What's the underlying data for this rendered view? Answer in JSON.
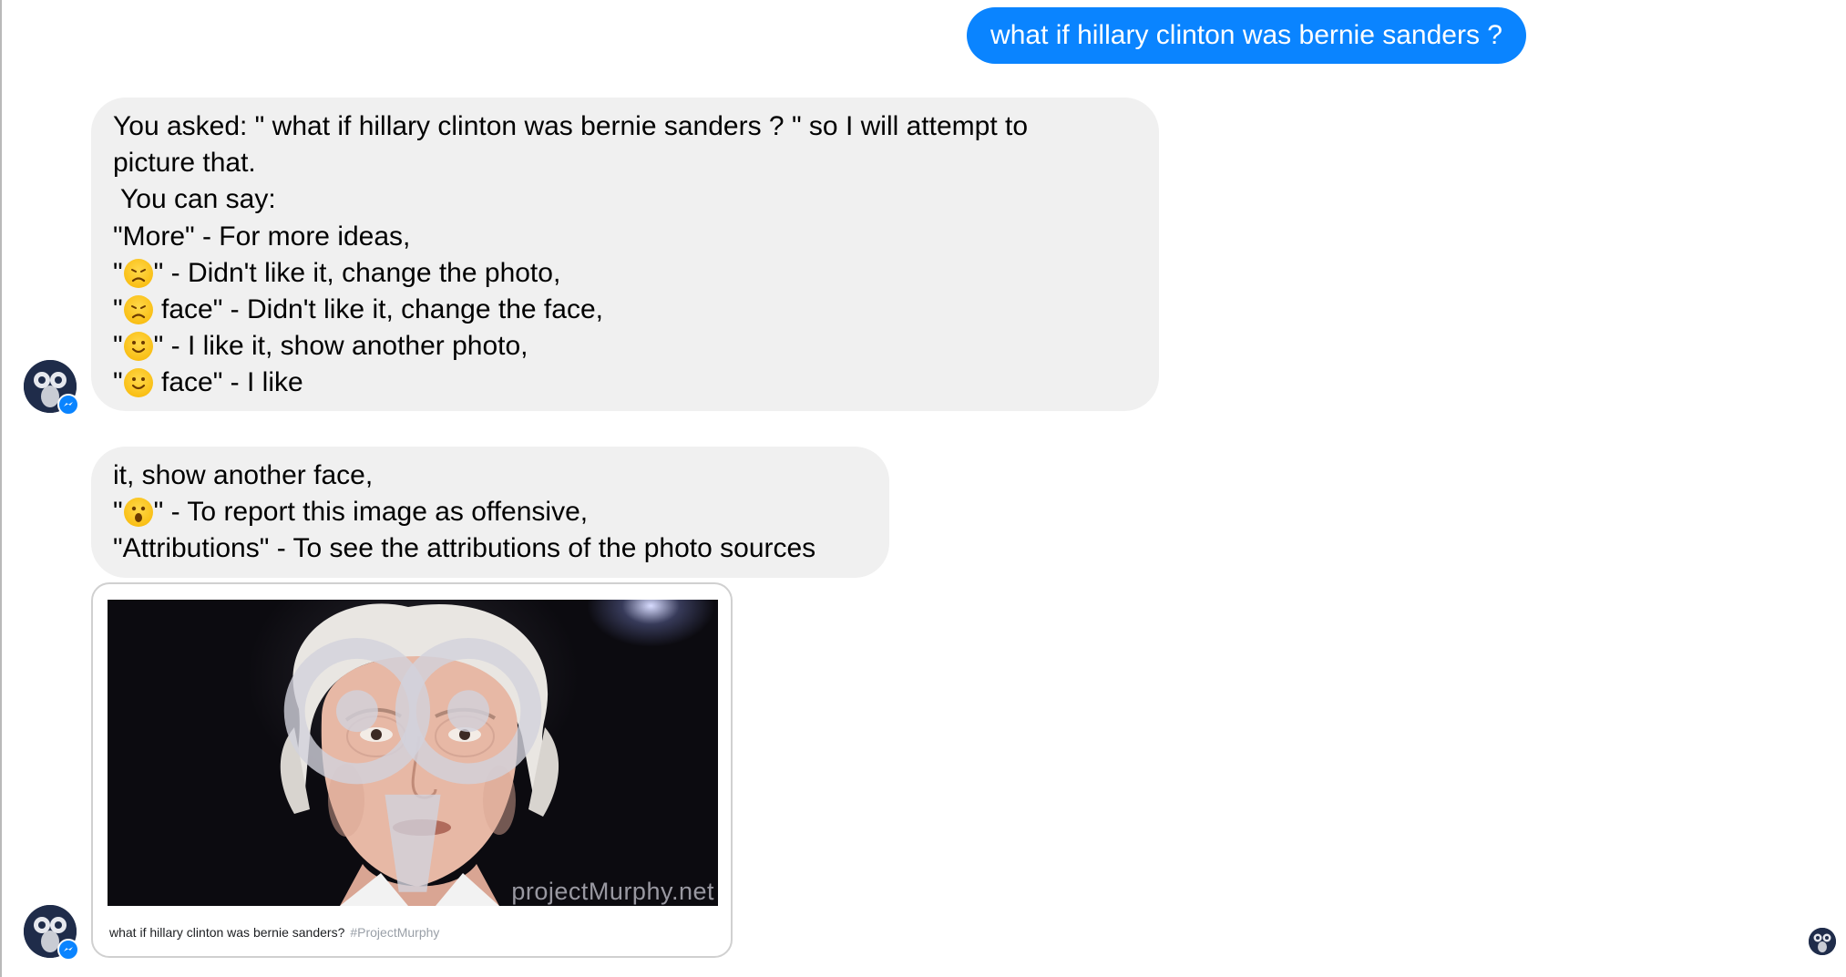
{
  "user_message": "what if hillary clinton was bernie sanders ?",
  "bot_message_1": {
    "line1": "You asked: \" what if hillary clinton was bernie sanders ? \" so I will attempt to",
    "line2": "picture that.",
    "line3": "You can say:",
    "line4": "\"More\" - For more ideas,",
    "line5_open": "\"",
    "line5_rest": "\" - Didn't like it, change the photo,",
    "line6_open": "\"",
    "line6_rest": " face\" - Didn't like it, change the face,",
    "line7_open": "\"",
    "line7_rest": "\" - I like it, show another photo,",
    "line8_open": "\"",
    "line8_rest": " face\" - I like"
  },
  "bot_message_2": {
    "line1": "it, show another face,",
    "line2_open": "\"",
    "line2_rest": "\" - To report this image as offensive,",
    "line3": "\"Attributions\" - To see the attributions of the photo sources"
  },
  "image_card": {
    "watermark": "projectMurphy.net",
    "caption": "what if hillary clinton was bernie sanders?",
    "hashtag": "#ProjectMurphy"
  },
  "icons": {
    "sad": "disappointed-face-icon",
    "smile": "slightly-smiling-face-icon",
    "surprised": "open-mouth-face-icon",
    "avatar": "project-murphy-bot-avatar",
    "badge": "messenger-badge-icon"
  },
  "colors": {
    "user_bubble": "#0a84ff",
    "bot_bubble": "#f0f0f0",
    "emoji_yellow": "#f7b500",
    "avatar_bg": "#1f2c4a"
  }
}
